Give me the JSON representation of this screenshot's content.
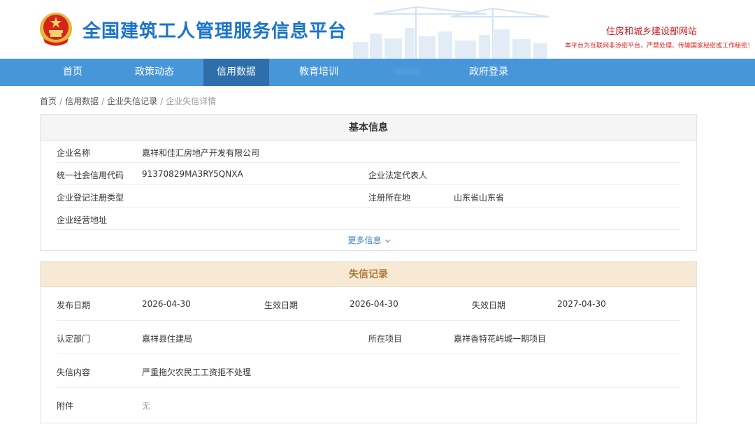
{
  "header": {
    "site_title": "全国建筑工人管理服务信息平台",
    "ministry_link": "住房和城乡建设部网站",
    "warning": "本平台为互联网非涉密平台，严禁处理、传输国家秘密或工作秘密！"
  },
  "nav": {
    "items": [
      {
        "label": "首页"
      },
      {
        "label": "政策动态"
      },
      {
        "label": "信用数据"
      },
      {
        "label": "教育培训"
      },
      {
        "label": "········"
      },
      {
        "label": "政府登录"
      }
    ],
    "active_index": 2
  },
  "breadcrumb": {
    "items": [
      "首页",
      "信用数据",
      "企业失信记录",
      "企业失信详情"
    ],
    "separator": "/"
  },
  "basic_info": {
    "title": "基本信息",
    "company_name_label": "企业名称",
    "company_name": "嘉祥和佳汇房地产开发有限公司",
    "credit_code_label": "统一社会信用代码",
    "credit_code": "91370829MA3RY5QNXA",
    "legal_rep_label": "企业法定代表人",
    "legal_rep": "",
    "reg_type_label": "企业登记注册类型",
    "reg_type": "",
    "reg_place_label": "注册所在地",
    "reg_place": "山东省山东省",
    "address_label": "企业经营地址",
    "address": "",
    "more_label": "更多信息"
  },
  "credit_record": {
    "title": "失信记录",
    "publish_date_label": "发布日期",
    "publish_date": "2026-04-30",
    "effective_date_label": "生效日期",
    "effective_date": "2026-04-30",
    "expire_date_label": "失效日期",
    "expire_date": "2027-04-30",
    "department_label": "认定部门",
    "department": "嘉祥县住建局",
    "project_label": "所在项目",
    "project": "嘉祥香特花屿城一期项目",
    "content_label": "失信内容",
    "content": "严重拖欠农民工工资拒不处理",
    "attachment_label": "附件",
    "attachment": "无"
  },
  "colors": {
    "brand_blue": "#1a74c9",
    "nav_bg": "#4896da",
    "nav_active": "#2e6eaa",
    "ministry_red": "#c9181f",
    "credit_header_bg": "#f7e9d3",
    "credit_header_text": "#b07a3a"
  }
}
